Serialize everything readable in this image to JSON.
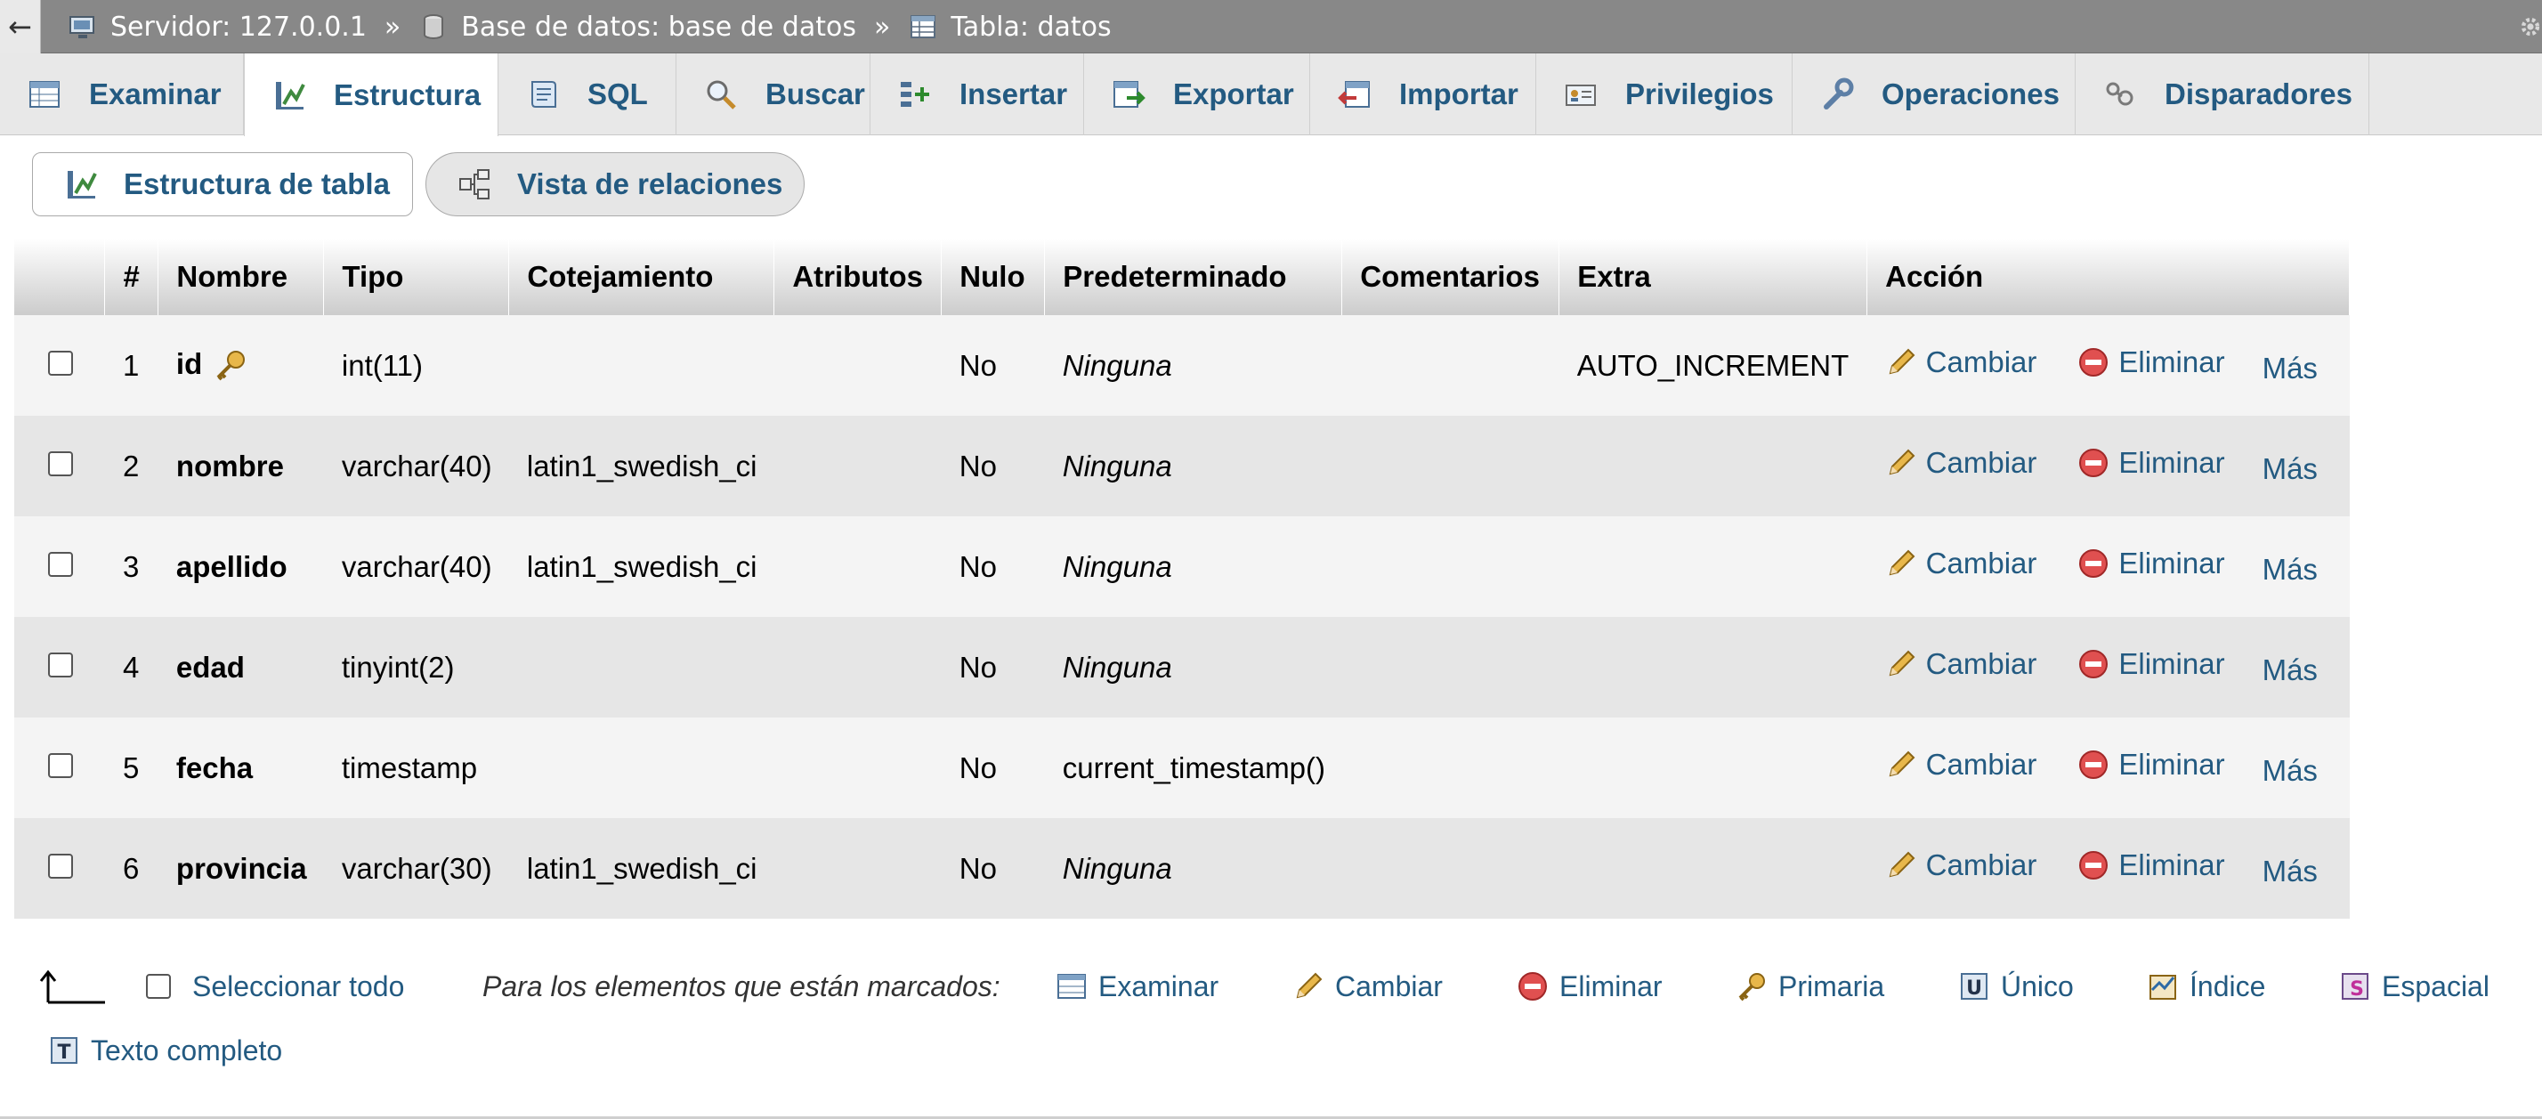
{
  "breadcrumb": {
    "back": "←",
    "server": "Servidor: 127.0.0.1",
    "database": "Base de datos: base de datos",
    "table": "Tabla: datos",
    "separator": "»"
  },
  "tabs": [
    {
      "label": "Examinar",
      "icon": "browse-icon"
    },
    {
      "label": "Estructura",
      "icon": "structure-icon",
      "active": true
    },
    {
      "label": "SQL",
      "icon": "sql-icon"
    },
    {
      "label": "Buscar",
      "icon": "search-icon"
    },
    {
      "label": "Insertar",
      "icon": "insert-icon"
    },
    {
      "label": "Exportar",
      "icon": "export-icon"
    },
    {
      "label": "Importar",
      "icon": "import-icon"
    },
    {
      "label": "Privilegios",
      "icon": "privileges-icon"
    },
    {
      "label": "Operaciones",
      "icon": "wrench-icon"
    },
    {
      "label": "Disparadores",
      "icon": "triggers-icon"
    }
  ],
  "subtabs": {
    "table_structure": "Estructura de tabla",
    "relation_view": "Vista de relaciones"
  },
  "table": {
    "headers": {
      "num": "#",
      "name": "Nombre",
      "type": "Tipo",
      "collation": "Cotejamiento",
      "attributes": "Atributos",
      "null": "Nulo",
      "default": "Predeterminado",
      "comments": "Comentarios",
      "extra": "Extra",
      "action": "Acción"
    },
    "rows": [
      {
        "num": "1",
        "name": "id",
        "type": "int(11)",
        "collation": "",
        "attributes": "",
        "null": "No",
        "default": "Ninguna",
        "comments": "",
        "extra": "AUTO_INCREMENT",
        "primary": true
      },
      {
        "num": "2",
        "name": "nombre",
        "type": "varchar(40)",
        "collation": "latin1_swedish_ci",
        "attributes": "",
        "null": "No",
        "default": "Ninguna",
        "comments": "",
        "extra": ""
      },
      {
        "num": "3",
        "name": "apellido",
        "type": "varchar(40)",
        "collation": "latin1_swedish_ci",
        "attributes": "",
        "null": "No",
        "default": "Ninguna",
        "comments": "",
        "extra": ""
      },
      {
        "num": "4",
        "name": "edad",
        "type": "tinyint(2)",
        "collation": "",
        "attributes": "",
        "null": "No",
        "default": "Ninguna",
        "comments": "",
        "extra": ""
      },
      {
        "num": "5",
        "name": "fecha",
        "type": "timestamp",
        "collation": "",
        "attributes": "",
        "null": "No",
        "default": "current_timestamp()",
        "comments": "",
        "extra": ""
      },
      {
        "num": "6",
        "name": "provincia",
        "type": "varchar(30)",
        "collation": "latin1_swedish_ci",
        "attributes": "",
        "null": "No",
        "default": "Ninguna",
        "comments": "",
        "extra": ""
      }
    ],
    "actions": {
      "change": "Cambiar",
      "drop": "Eliminar",
      "more": "Más"
    }
  },
  "footer": {
    "select_all": "Seleccionar todo",
    "with_selected": "Para los elementos que están marcados:",
    "browse": "Examinar",
    "change": "Cambiar",
    "drop": "Eliminar",
    "primary": "Primaria",
    "unique": "Único",
    "index": "Índice",
    "spatial": "Espacial",
    "fulltext": "Texto completo"
  }
}
